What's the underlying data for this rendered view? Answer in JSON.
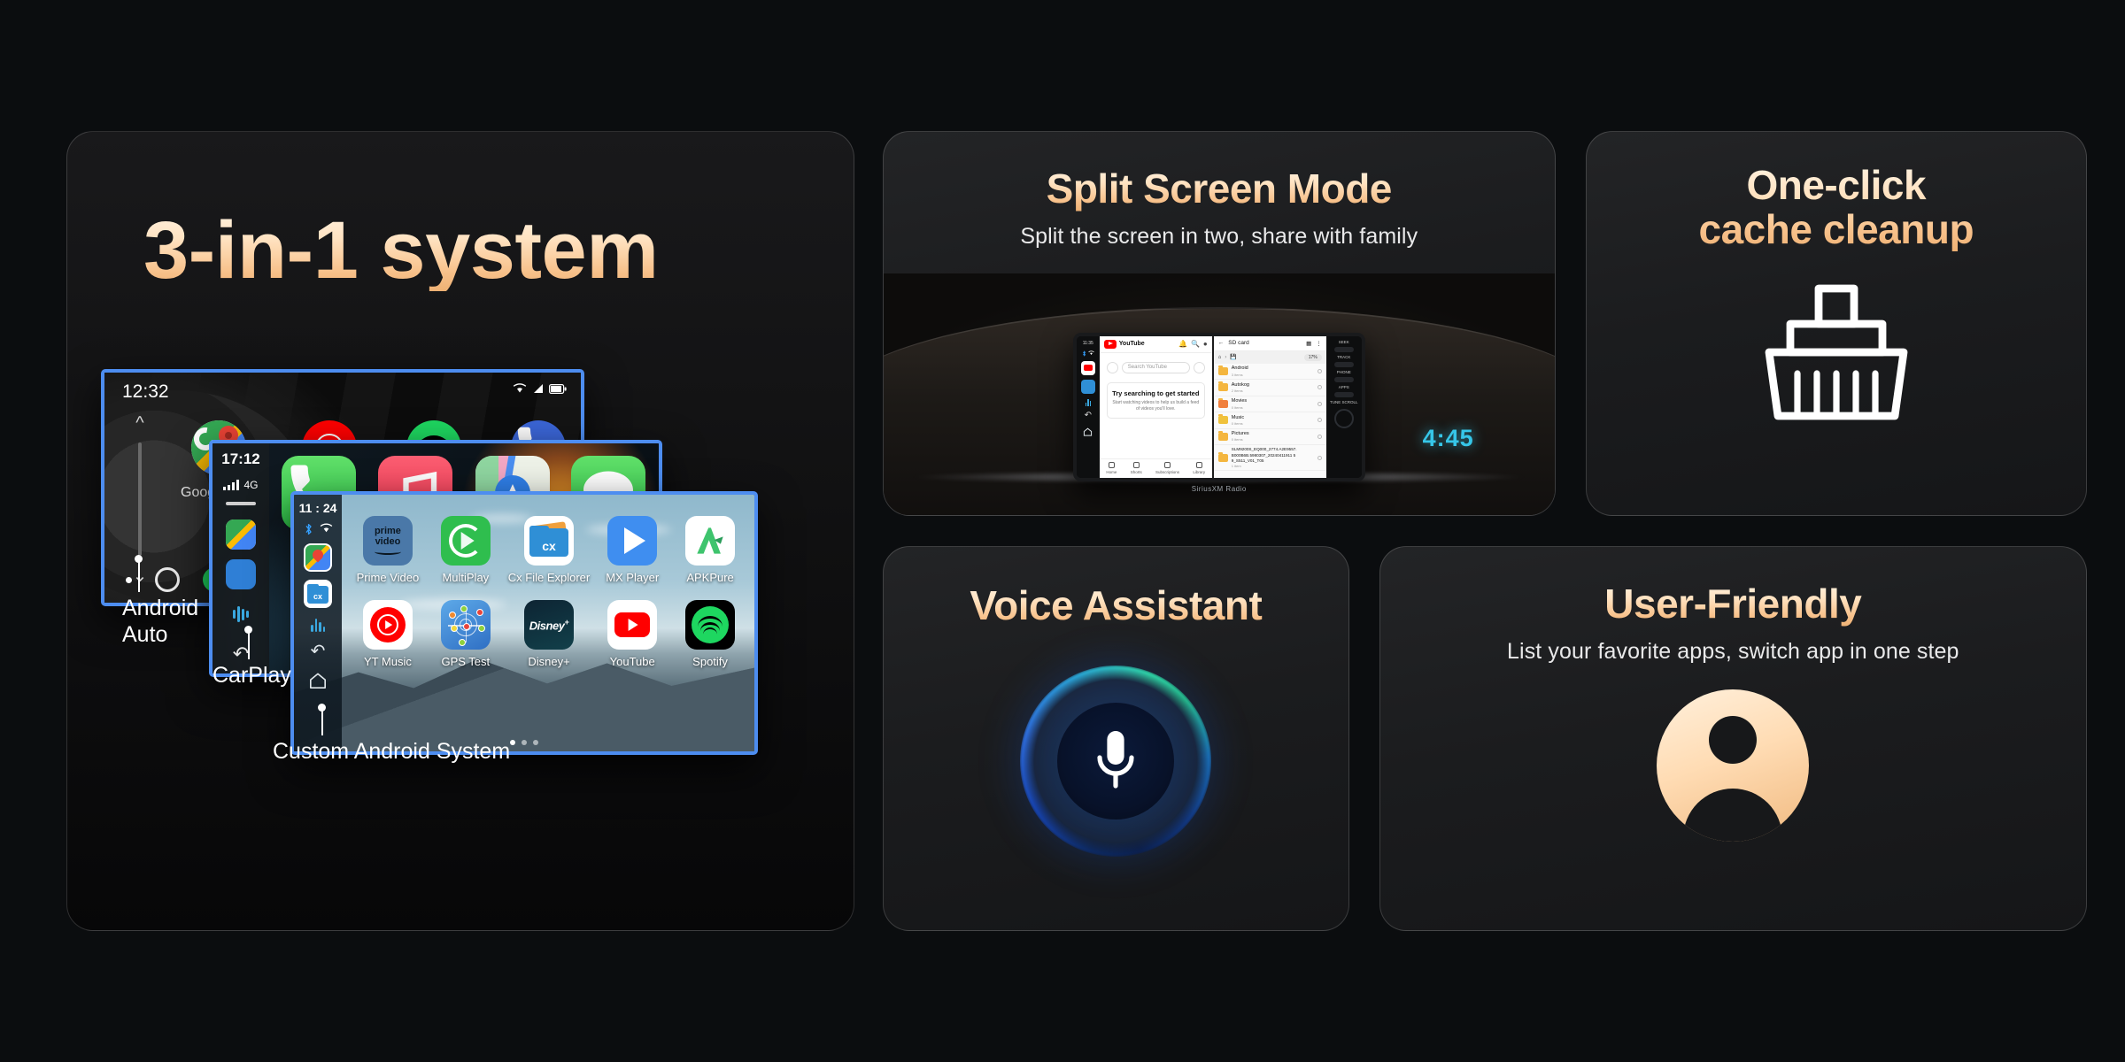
{
  "hero": {
    "title": "3-in-1 system",
    "callouts": [
      {
        "name": "android-auto",
        "line1": "Android",
        "line2": "Auto"
      },
      {
        "name": "carplay",
        "line1": "CarPlay",
        "line2": ""
      },
      {
        "name": "custom-android",
        "line1": "Custom Android System",
        "line2": ""
      }
    ],
    "android_auto": {
      "time": "12:32",
      "apps": [
        {
          "label": "Google Maps",
          "icon": "google-maps-icon"
        },
        {
          "label": "YT Music",
          "icon": "yt-music-icon"
        },
        {
          "label": "Spotify",
          "icon": "spotify-icon"
        },
        {
          "label": "Phone",
          "icon": "phone-icon"
        }
      ]
    },
    "carplay": {
      "time": "17:12",
      "network": "4G",
      "apps": [
        {
          "label": "Phone",
          "icon": "phone-icon"
        },
        {
          "label": "Now Playing",
          "icon": "music-icon"
        },
        {
          "label": "Maps",
          "icon": "apple-maps-icon"
        },
        {
          "label": "Messages",
          "icon": "messages-icon"
        }
      ],
      "sidebar_icons": [
        "maps-icon",
        "camera-icon",
        "audio-wave-icon",
        "back-icon",
        "split-icon"
      ]
    },
    "custom_android": {
      "time": "11 : 24",
      "status_icons": [
        "bluetooth-icon",
        "wifi-icon"
      ],
      "sidebar_icons": [
        "google-maps-icon",
        "cx-file-explorer-icon",
        "audio-wave-icon",
        "back-icon",
        "home-icon"
      ],
      "apps": [
        {
          "label": "Prime Video",
          "icon": "prime-video-icon"
        },
        {
          "label": "MultiPlay",
          "icon": "multiplay-icon"
        },
        {
          "label": "Cx File Explorer",
          "icon": "cx-file-explorer-icon"
        },
        {
          "label": "MX Player",
          "icon": "mx-player-icon"
        },
        {
          "label": "APKPure",
          "icon": "apkpure-icon"
        },
        {
          "label": "YT Music",
          "icon": "yt-music-icon"
        },
        {
          "label": "GPS Test",
          "icon": "gps-test-icon"
        },
        {
          "label": "Disney+",
          "icon": "disney-plus-icon"
        },
        {
          "label": "YouTube",
          "icon": "youtube-icon"
        },
        {
          "label": "Spotify",
          "icon": "spotify-icon"
        }
      ],
      "page_dots": 3,
      "active_dot": 1
    }
  },
  "split_screen": {
    "title": "Split Screen Mode",
    "subtitle": "Split the screen in two, share with family",
    "head_unit": {
      "clock": "4:45",
      "brand": "SiriusXM   Radio",
      "left_time": "11:35",
      "youtube": {
        "brand": "YouTube",
        "search_placeholder": "Search YouTube",
        "cta_title": "Try searching to get started",
        "cta_body": "Start watching videos to help us build a feed of videos you'll love.",
        "tabs": [
          "Home",
          "Shorts",
          "Subscriptions",
          "Library"
        ]
      },
      "files": {
        "title": "SD card",
        "storage": "17%",
        "rows": [
          {
            "name": "Android",
            "items": "3 items"
          },
          {
            "name": "Autokog",
            "items": "2 items"
          },
          {
            "name": "Movies",
            "items": "0 items"
          },
          {
            "name": "Music",
            "items": "0 items"
          },
          {
            "name": "Pictures",
            "items": "0 items"
          },
          {
            "name": "SLM9200S_EQ000_2774.A2E9557.B000B6B.5980307_20240411911 59_S511_V01_T05",
            "items": "1 item"
          }
        ]
      },
      "buttons": [
        "SEEK",
        "TRACK",
        "PHONE",
        "APPS",
        "TUNE SCROLL"
      ]
    }
  },
  "cleanup": {
    "title_line1": "One-click",
    "title_line2": "cache cleanup",
    "icon": "broom-icon"
  },
  "voice": {
    "title": "Voice Assistant",
    "icon": "microphone-icon"
  },
  "user_friendly": {
    "title": "User-Friendly",
    "subtitle": "List your favorite apps, switch app in one step",
    "icon": "user-avatar-icon"
  },
  "colors": {
    "accent_gold": "#f7c089",
    "accent_cream": "#fff2e0",
    "page_bg": "#0b0d0f",
    "card_bg": "#1b1c1e",
    "mock_border": "#4d8df0",
    "clock_cyan": "#36c6e8"
  }
}
